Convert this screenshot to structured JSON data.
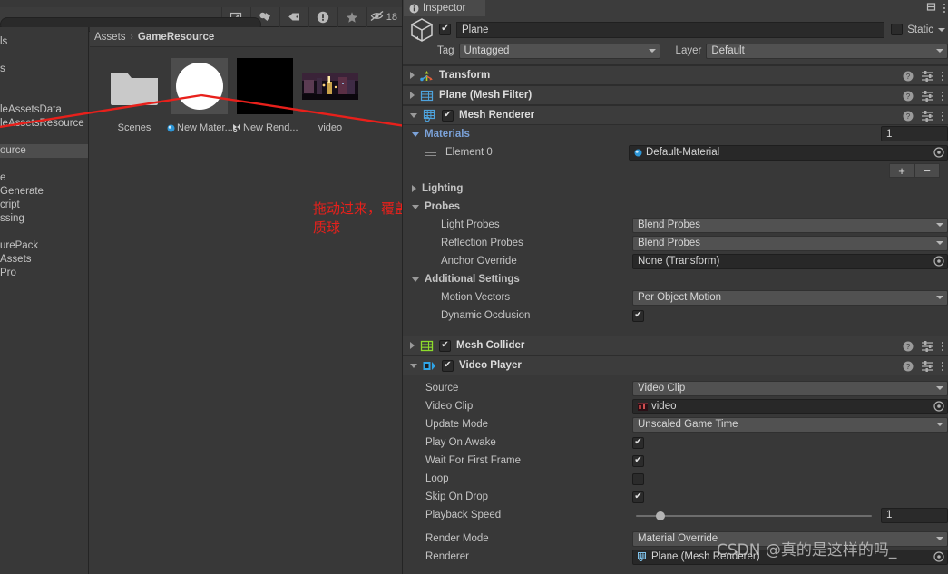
{
  "project": {
    "toolbar": {
      "search_placeholder": "",
      "search_value": "",
      "icons": [
        "popout-icon",
        "asset-type-icon",
        "label-icon",
        "warning-icon",
        "favorite-icon"
      ],
      "hidden_count": "18",
      "hidden_icon": "eye-off-icon"
    },
    "tree": [
      {
        "label": "ls",
        "selected": false
      },
      {
        "label": "s",
        "selected": false
      },
      {
        "label": "leAssetsData",
        "selected": false
      },
      {
        "label": "leAssetsResource",
        "selected": false
      },
      {
        "label": "ource",
        "selected": true
      },
      {
        "label": "e",
        "selected": false
      },
      {
        "label": "Generate",
        "selected": false
      },
      {
        "label": "cript",
        "selected": false
      },
      {
        "label": "ssing",
        "selected": false
      },
      {
        "label": "urePack",
        "selected": false
      },
      {
        "label": "Assets",
        "selected": false
      },
      {
        "label": "Pro",
        "selected": false
      }
    ],
    "breadcrumb": {
      "root": "Assets",
      "separator": "›",
      "current": "GameResource"
    },
    "assets": [
      {
        "name": "Scenes",
        "icon": "folder-icon",
        "badge": null
      },
      {
        "name": "New Mater...",
        "icon": "material-sphere-icon",
        "badge": "material-badge-icon"
      },
      {
        "name": "New Rend...",
        "icon": "render-texture-icon",
        "badge": "render-texture-badge-icon"
      },
      {
        "name": "video",
        "icon": "video-thumbnail-icon",
        "badge": null
      }
    ],
    "annotation": "拖动过来，覆盖原来的默认材质球"
  },
  "inspector": {
    "tab": {
      "label": "Inspector",
      "icon": "info-icon"
    },
    "lock_icon": "lock-icon",
    "menu_icon": "kebab-icon",
    "gameobject": {
      "icon": "gameobject-cube-icon",
      "enabled": true,
      "name": "Plane",
      "static_label": "Static",
      "static_checked": false,
      "tag_label": "Tag",
      "tag_value": "Untagged",
      "layer_label": "Layer",
      "layer_value": "Default"
    },
    "components": [
      {
        "name": "Transform",
        "icon": "transform-icon",
        "expanded": false,
        "has_toggle": false,
        "enabled": false
      },
      {
        "name": "Plane (Mesh Filter)",
        "icon": "mesh-filter-icon",
        "expanded": false,
        "has_toggle": false,
        "enabled": false
      },
      {
        "name": "Mesh Renderer",
        "icon": "mesh-renderer-icon",
        "expanded": true,
        "has_toggle": true,
        "enabled": true
      },
      {
        "name": "Mesh Collider",
        "icon": "mesh-collider-icon",
        "expanded": false,
        "has_toggle": true,
        "enabled": true
      },
      {
        "name": "Video Player",
        "icon": "video-player-icon",
        "expanded": true,
        "has_toggle": true,
        "enabled": true
      }
    ],
    "mesh_renderer": {
      "materials": {
        "title": "Materials",
        "title_color": "#7ba2d9",
        "count": "1",
        "element_label": "Element 0",
        "element_value": "Default-Material",
        "element_icon": "material-badge-icon",
        "add_label": "+",
        "remove_label": "−"
      },
      "lighting": {
        "title": "Lighting",
        "expanded": false
      },
      "probes": {
        "title": "Probes",
        "expanded": true,
        "rows": [
          {
            "label": "Light Probes",
            "type": "dropdown",
            "value": "Blend Probes"
          },
          {
            "label": "Reflection Probes",
            "type": "dropdown",
            "value": "Blend Probes"
          },
          {
            "label": "Anchor Override",
            "type": "object",
            "value": "None (Transform)"
          }
        ]
      },
      "additional_settings": {
        "title": "Additional Settings",
        "expanded": true,
        "rows": [
          {
            "label": "Motion Vectors",
            "type": "dropdown",
            "value": "Per Object Motion"
          },
          {
            "label": "Dynamic Occlusion",
            "type": "checkbox",
            "checked": true
          }
        ]
      }
    },
    "video_player": {
      "rows": [
        {
          "label": "Source",
          "type": "dropdown",
          "value": "Video Clip"
        },
        {
          "label": "Video Clip",
          "type": "object",
          "value": "video",
          "icon": "video-clip-icon"
        },
        {
          "label": "Update Mode",
          "type": "dropdown",
          "value": "Unscaled Game Time"
        },
        {
          "label": "Play On Awake",
          "type": "checkbox",
          "checked": true
        },
        {
          "label": "Wait For First Frame",
          "type": "checkbox",
          "checked": true
        },
        {
          "label": "Loop",
          "type": "checkbox",
          "checked": false
        },
        {
          "label": "Skip On Drop",
          "type": "checkbox",
          "checked": true
        },
        {
          "label": "Playback Speed",
          "type": "slider",
          "value": "1"
        },
        {
          "label": "Render Mode",
          "type": "dropdown",
          "value": "Material Override"
        },
        {
          "label": "Renderer",
          "type": "object",
          "value": "Plane (Mesh Renderer)",
          "icon": "mesh-renderer-icon"
        }
      ]
    }
  },
  "watermark": "CSDN @真的是这样的吗_"
}
